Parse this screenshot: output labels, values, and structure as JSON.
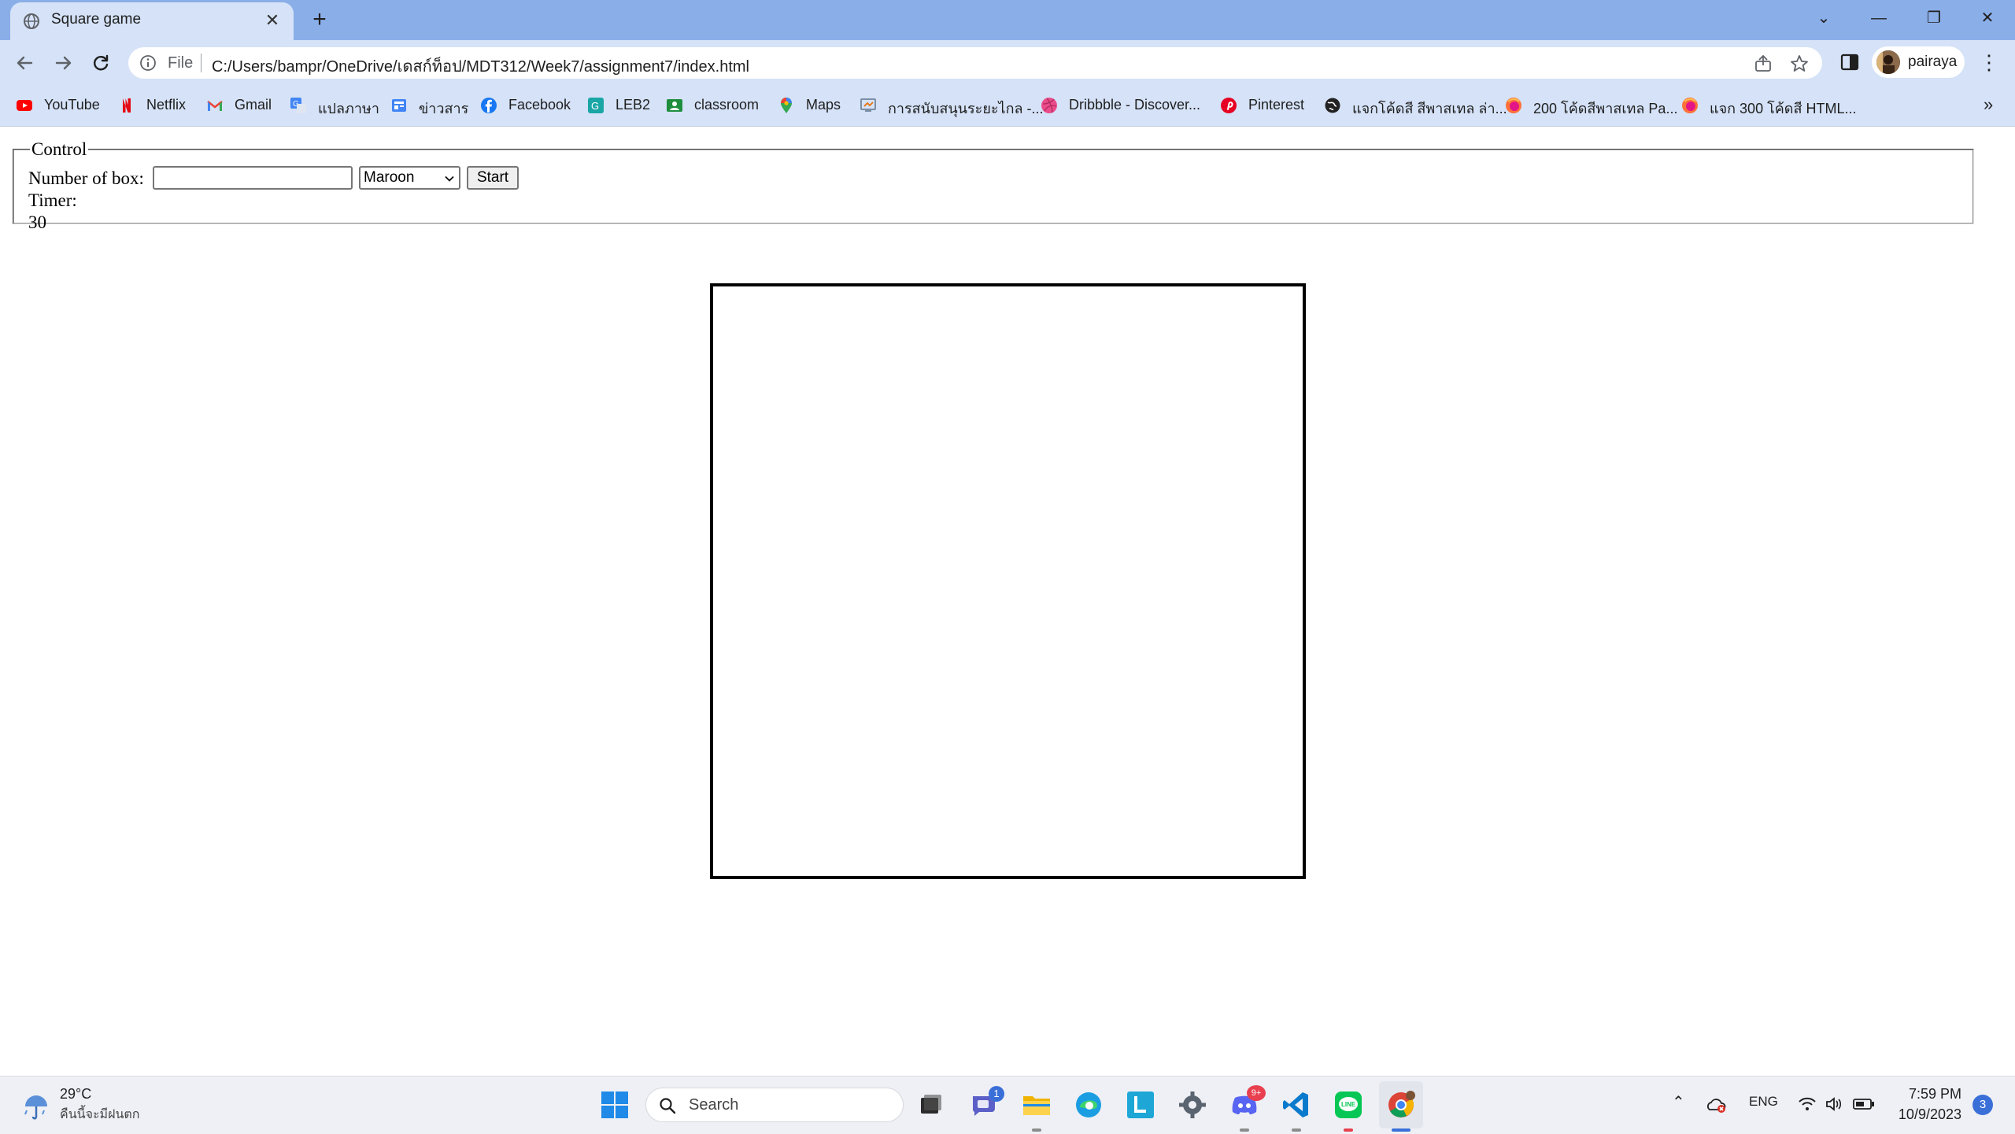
{
  "browser": {
    "tab": {
      "title": "Square game",
      "close": "✕"
    },
    "new_tab": "+",
    "window_controls": {
      "minimize": "—",
      "restore": "❐",
      "close": "✕",
      "tab_search": "⌄"
    },
    "omnibox": {
      "scheme_label": "File",
      "url": "C:/Users/bampr/OneDrive/เดสก์ท็อป/MDT312/Week7/assignment7/index.html"
    },
    "profile": {
      "name": "pairaya"
    },
    "menu": "⋮",
    "bookmarks": [
      {
        "label": "YouTube",
        "icon": "youtube-icon",
        "color": "#ff0000"
      },
      {
        "label": "Netflix",
        "icon": "netflix-icon",
        "color": "#e50914"
      },
      {
        "label": "Gmail",
        "icon": "gmail-icon",
        "color": "#ea4335"
      },
      {
        "label": "แปลภาษา",
        "icon": "translate-icon",
        "color": "#4285f4"
      },
      {
        "label": "ข่าวสาร",
        "icon": "news-icon",
        "color": "#4285f4"
      },
      {
        "label": "Facebook",
        "icon": "facebook-icon",
        "color": "#1877f2"
      },
      {
        "label": "LEB2",
        "icon": "leb2-icon",
        "color": "#1ba6a6"
      },
      {
        "label": "classroom",
        "icon": "classroom-icon",
        "color": "#1e8e3e"
      },
      {
        "label": "Maps",
        "icon": "maps-icon",
        "color": "#34a853"
      },
      {
        "label": "การสนับสนุนระยะไกล -...",
        "icon": "remote-support-icon",
        "color": "#7c8fa6"
      },
      {
        "label": "Dribbble - Discover...",
        "icon": "dribbble-icon",
        "color": "#ea4c89"
      },
      {
        "label": "Pinterest",
        "icon": "pinterest-icon",
        "color": "#e60023"
      },
      {
        "label": "แจกโค้ดสี สีพาสเทล ล่า...",
        "icon": "globe-icon",
        "color": "#222222"
      },
      {
        "label": "200 โค้ดสีพาสเทล Pa...",
        "icon": "firefox-icon",
        "color": "#ff7139"
      },
      {
        "label": "แจก 300 โค้ดสี HTML...",
        "icon": "firefox-icon",
        "color": "#ff7139"
      }
    ],
    "bookmarks_more": "»"
  },
  "page": {
    "control": {
      "legend": "Control",
      "number_label": "Number of box:",
      "number_value": "",
      "color_selected": "Maroon",
      "start_label": "Start",
      "timer_label": "Timer:",
      "timer_value": "30"
    }
  },
  "taskbar": {
    "weather": {
      "temp": "29°C",
      "desc": "คืนนี้จะมีฝนตก"
    },
    "search_placeholder": "Search",
    "badges": {
      "teams": "1",
      "discord": "9+"
    },
    "tray": {
      "lang": "ENG"
    },
    "clock": {
      "time": "7:59 PM",
      "date": "10/9/2023"
    },
    "notifications": "3"
  },
  "colors": {
    "tab_strip": "#8aaee8",
    "toolbar": "#d5e2f7",
    "accent": "#3a6fd8"
  }
}
